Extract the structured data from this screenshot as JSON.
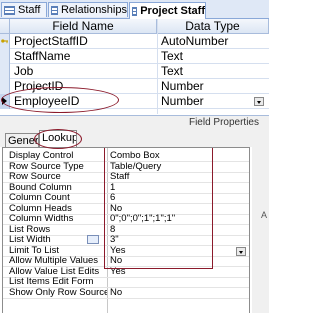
{
  "tabs": [
    {
      "label": "Staff",
      "active": false
    },
    {
      "label": "Relationships",
      "active": false
    },
    {
      "label": "Project Staff",
      "active": true
    }
  ],
  "grid": {
    "headers": {
      "field_name": "Field Name",
      "data_type": "Data Type"
    },
    "rows": [
      {
        "field": "ProjectStaffID",
        "type": "AutoNumber",
        "primary_key": true
      },
      {
        "field": "StaffName",
        "type": "Text",
        "primary_key": false
      },
      {
        "field": "Job",
        "type": "Text",
        "primary_key": false
      },
      {
        "field": "ProjectID",
        "type": "Number",
        "primary_key": false
      },
      {
        "field": "EmployeeID",
        "type": "Number",
        "primary_key": false,
        "selected": true
      }
    ]
  },
  "field_properties_label": "Field Properties",
  "property_tabs": [
    {
      "label": "General",
      "active": false
    },
    {
      "label": "Lookup",
      "active": true
    }
  ],
  "properties": [
    {
      "name": "Display Control",
      "value": "Combo Box"
    },
    {
      "name": "Row Source Type",
      "value": "Table/Query"
    },
    {
      "name": "Row Source",
      "value": "Staff"
    },
    {
      "name": "Bound Column",
      "value": "1"
    },
    {
      "name": "Column Count",
      "value": "6"
    },
    {
      "name": "Column Heads",
      "value": "No"
    },
    {
      "name": "Column Widths",
      "value": "0\";0\";0\";1\";1\";1\""
    },
    {
      "name": "List Rows",
      "value": "8"
    },
    {
      "name": "List Width",
      "value": "3\""
    },
    {
      "name": "Limit To List",
      "value": "Yes"
    },
    {
      "name": "Allow Multiple Values",
      "value": "No"
    },
    {
      "name": "Allow Value List Edits",
      "value": "Yes"
    },
    {
      "name": "List Items Edit Form",
      "value": ""
    },
    {
      "name": "Show Only Row Source V",
      "value": "No"
    }
  ],
  "help_text_fragment": "A",
  "colors": {
    "annotation": "#8b1a2b",
    "tab_bg": "#dfe8f6",
    "border": "#8aa8d8"
  }
}
